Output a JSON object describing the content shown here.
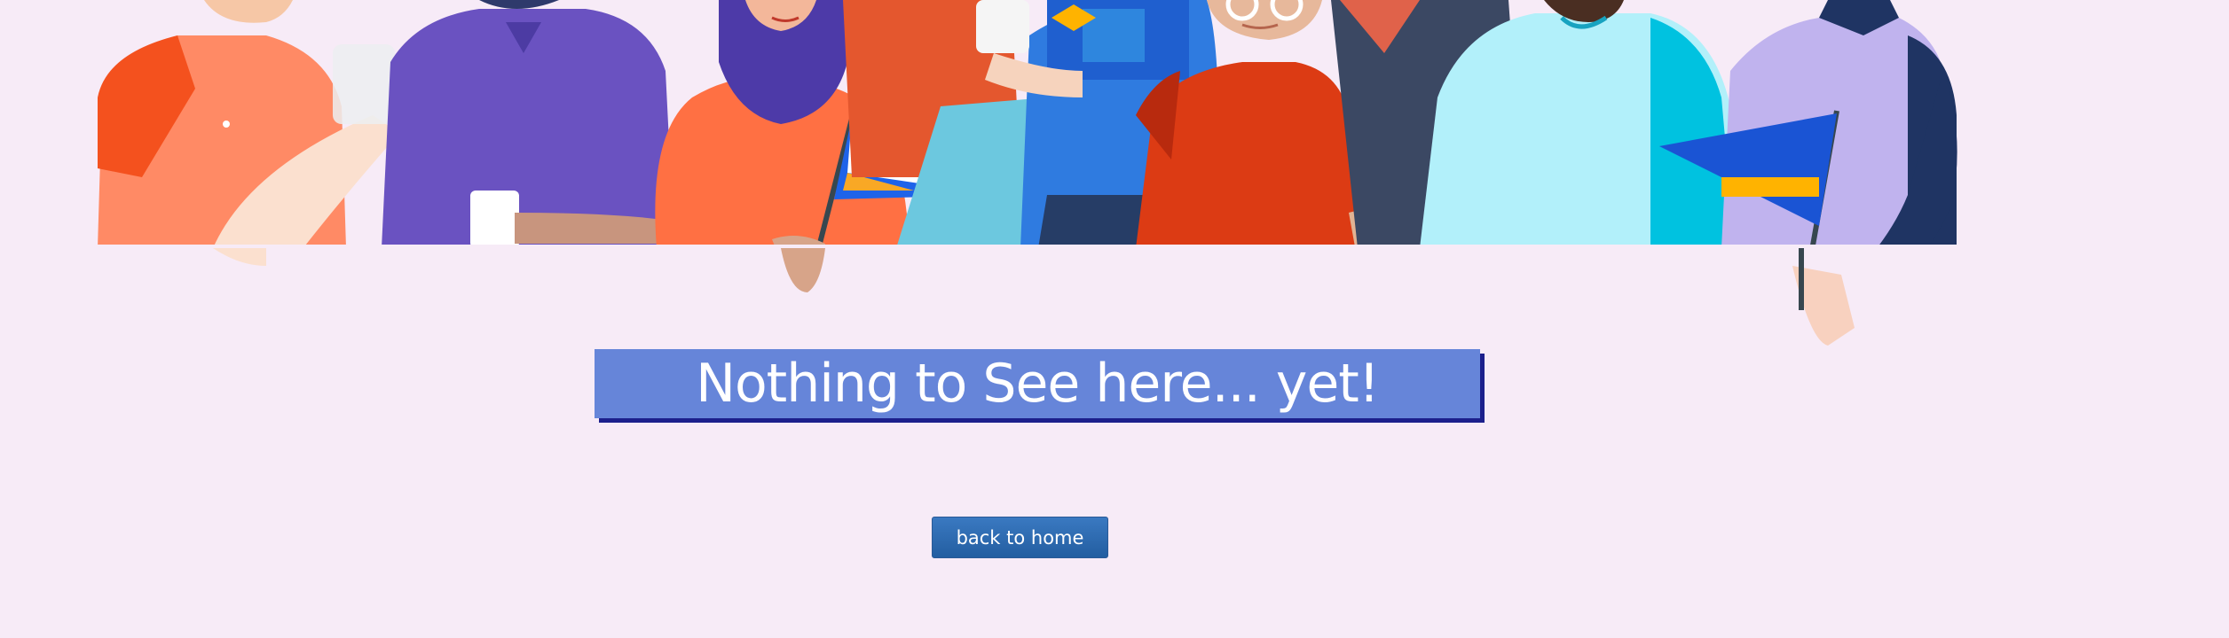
{
  "page": {
    "headline": "Nothing to See here... yet!",
    "back_button_label": "back to home"
  },
  "colors": {
    "background": "#f7ebf7",
    "headline_box": "#6685d9",
    "headline_shadow": "#1c1f8c",
    "button": "#2b68b0"
  },
  "illustration": {
    "name": "crowd-of-people-illustration"
  }
}
